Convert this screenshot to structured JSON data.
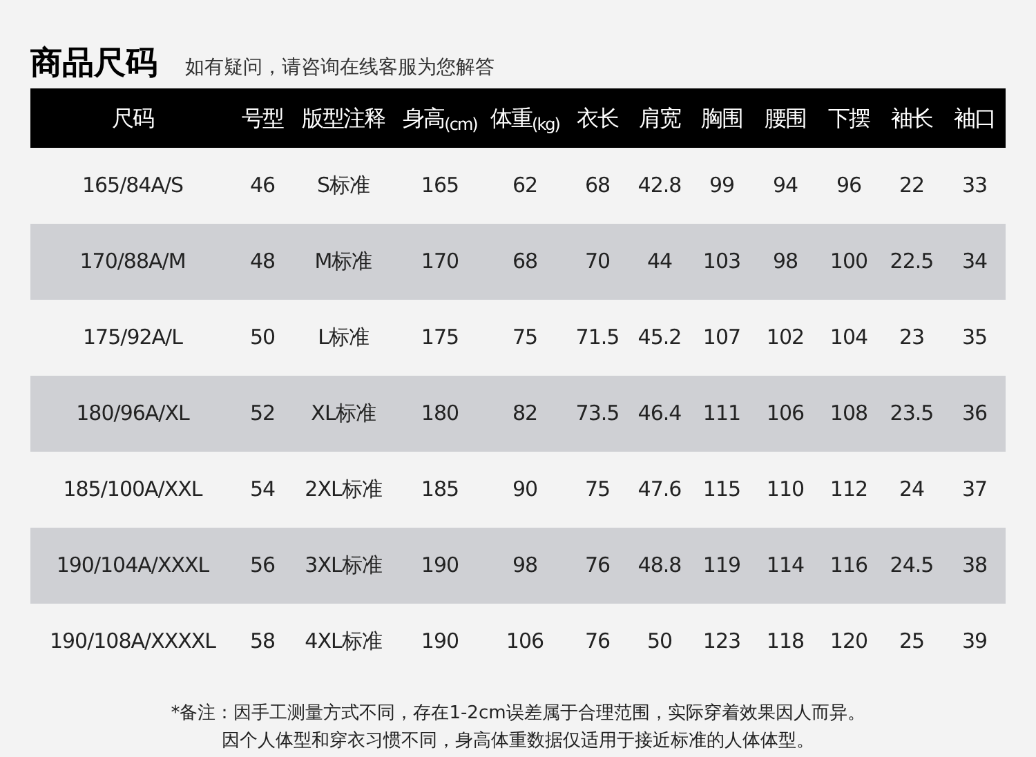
{
  "title": "商品尺码",
  "subtitle": "如有疑问，请咨询在线客服为您解答",
  "table": {
    "columns": [
      "尺码",
      "号型",
      "版型注释",
      "身高$_{(cm)}$",
      "体重$_{(kg)}$",
      "衣长",
      "肩宽",
      "胸围",
      "腰围",
      "下摆",
      "袖长",
      "袖口"
    ],
    "rows": [
      [
        "165/84A/S",
        "46",
        "S标准",
        "165",
        "62",
        "68",
        "42.8",
        "99",
        "94",
        "96",
        "22",
        "33"
      ],
      [
        "170/88A/M",
        "48",
        "M标准",
        "170",
        "68",
        "70",
        "44",
        "103",
        "98",
        "100",
        "22.5",
        "34"
      ],
      [
        "175/92A/L",
        "50",
        "L标准",
        "175",
        "75",
        "71.5",
        "45.2",
        "107",
        "102",
        "104",
        "23",
        "35"
      ],
      [
        "180/96A/XL",
        "52",
        "XL标准",
        "180",
        "82",
        "73.5",
        "46.4",
        "111",
        "106",
        "108",
        "23.5",
        "36"
      ],
      [
        "185/100A/XXL",
        "54",
        "2XL标准",
        "185",
        "90",
        "75",
        "47.6",
        "115",
        "110",
        "112",
        "24",
        "37"
      ],
      [
        "190/104A/XXXL",
        "56",
        "3XL标准",
        "190",
        "98",
        "76",
        "48.8",
        "119",
        "114",
        "116",
        "24.5",
        "38"
      ],
      [
        "190/108A/XXXXL",
        "58",
        "4XL标准",
        "190",
        "106",
        "76",
        "50",
        "123",
        "118",
        "120",
        "25",
        "39"
      ]
    ]
  },
  "notes": [
    "*备注：因手工测量方式不同，存在1-2cm误差属于合理范围，实际穿着效果因人而异。",
    "因个人体型和穿衣习惯不同，身高体重数据仅适用于接近标准的人体体型。"
  ]
}
